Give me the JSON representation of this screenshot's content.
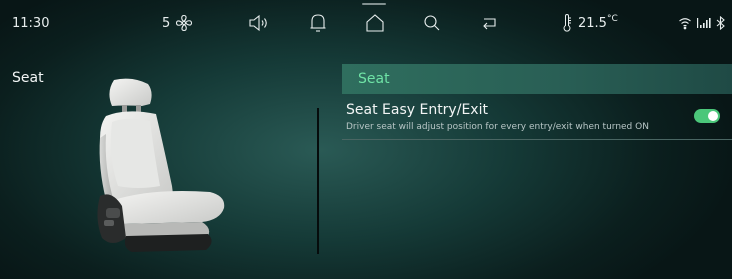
{
  "statusbar": {
    "time": "11:30",
    "fan_level": "5",
    "temperature": "21.5",
    "temperature_unit": "°C",
    "icons": [
      "fan-icon",
      "volume-icon",
      "bell-icon",
      "home-icon",
      "search-icon",
      "return-icon",
      "thermometer-icon",
      "wifi-icon",
      "signal-icon",
      "bluetooth-icon"
    ]
  },
  "page": {
    "title": "Seat"
  },
  "section": {
    "title": "Seat"
  },
  "setting": {
    "title": "Seat Easy Entry/Exit",
    "description": "Driver seat will adjust position for every entry/exit when turned ON",
    "enabled": true
  },
  "colors": {
    "accent_green": "#6fe3a6",
    "toggle_on": "#4bc77a",
    "header_band": "#2f6e5e"
  }
}
